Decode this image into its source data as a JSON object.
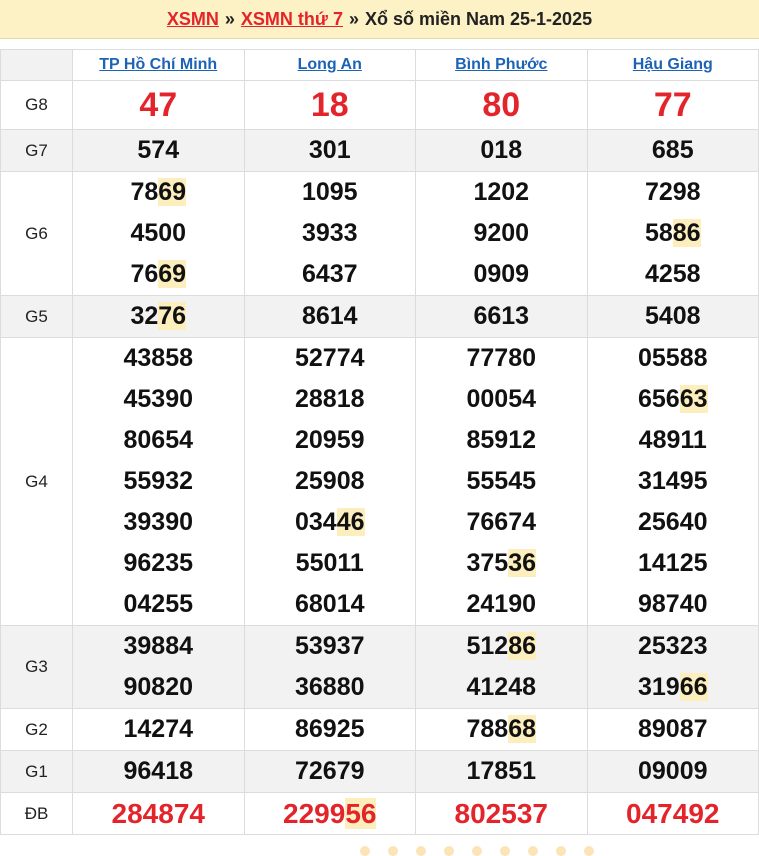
{
  "header": {
    "link1": "XSMN",
    "sep1": "»",
    "link2": "XSMN thứ 7",
    "sep2": "»",
    "title": "Xổ số miền Nam 25-1-2025"
  },
  "provinces": [
    "TP Hồ Chí Minh",
    "Long An",
    "Bình Phước",
    "Hậu Giang"
  ],
  "prizes": [
    {
      "label": "G8",
      "red": true,
      "rows": [
        [
          "47",
          "18",
          "80",
          "77"
        ]
      ]
    },
    {
      "label": "G7",
      "rows": [
        [
          "574",
          "301",
          "018",
          "685"
        ]
      ]
    },
    {
      "label": "G6",
      "rows": [
        [
          "7869",
          "1095",
          "1202",
          "7298"
        ],
        [
          "4500",
          "3933",
          "9200",
          "5886"
        ],
        [
          "7669",
          "6437",
          "0909",
          "4258"
        ]
      ]
    },
    {
      "label": "G5",
      "rows": [
        [
          "3276",
          "8614",
          "6613",
          "5408"
        ]
      ]
    },
    {
      "label": "G4",
      "rows": [
        [
          "43858",
          "52774",
          "77780",
          "05588"
        ],
        [
          "45390",
          "28818",
          "00054",
          "65663"
        ],
        [
          "80654",
          "20959",
          "85912",
          "48911"
        ],
        [
          "55932",
          "25908",
          "55545",
          "31495"
        ],
        [
          "39390",
          "03446",
          "76674",
          "25640"
        ],
        [
          "96235",
          "55011",
          "37536",
          "14125"
        ],
        [
          "04255",
          "68014",
          "24190",
          "98740"
        ]
      ]
    },
    {
      "label": "G3",
      "rows": [
        [
          "39884",
          "53937",
          "51286",
          "25323"
        ],
        [
          "90820",
          "36880",
          "41248",
          "31966"
        ]
      ]
    },
    {
      "label": "G2",
      "rows": [
        [
          "14274",
          "86925",
          "78868",
          "89087"
        ]
      ]
    },
    {
      "label": "G1",
      "rows": [
        [
          "96418",
          "72679",
          "17851",
          "09009"
        ]
      ]
    },
    {
      "label": "ĐB",
      "red": true,
      "rows": [
        [
          "284874",
          "229956",
          "802537",
          "047492"
        ]
      ]
    }
  ],
  "highlight_tails": [
    "69",
    "76",
    "46",
    "36",
    "86",
    "68",
    "63",
    "66",
    "56"
  ],
  "colors": {
    "red": "#e3242b",
    "link": "#1d63b5",
    "header_bg": "#fdf1c6",
    "highlight": "#fdeebd"
  }
}
